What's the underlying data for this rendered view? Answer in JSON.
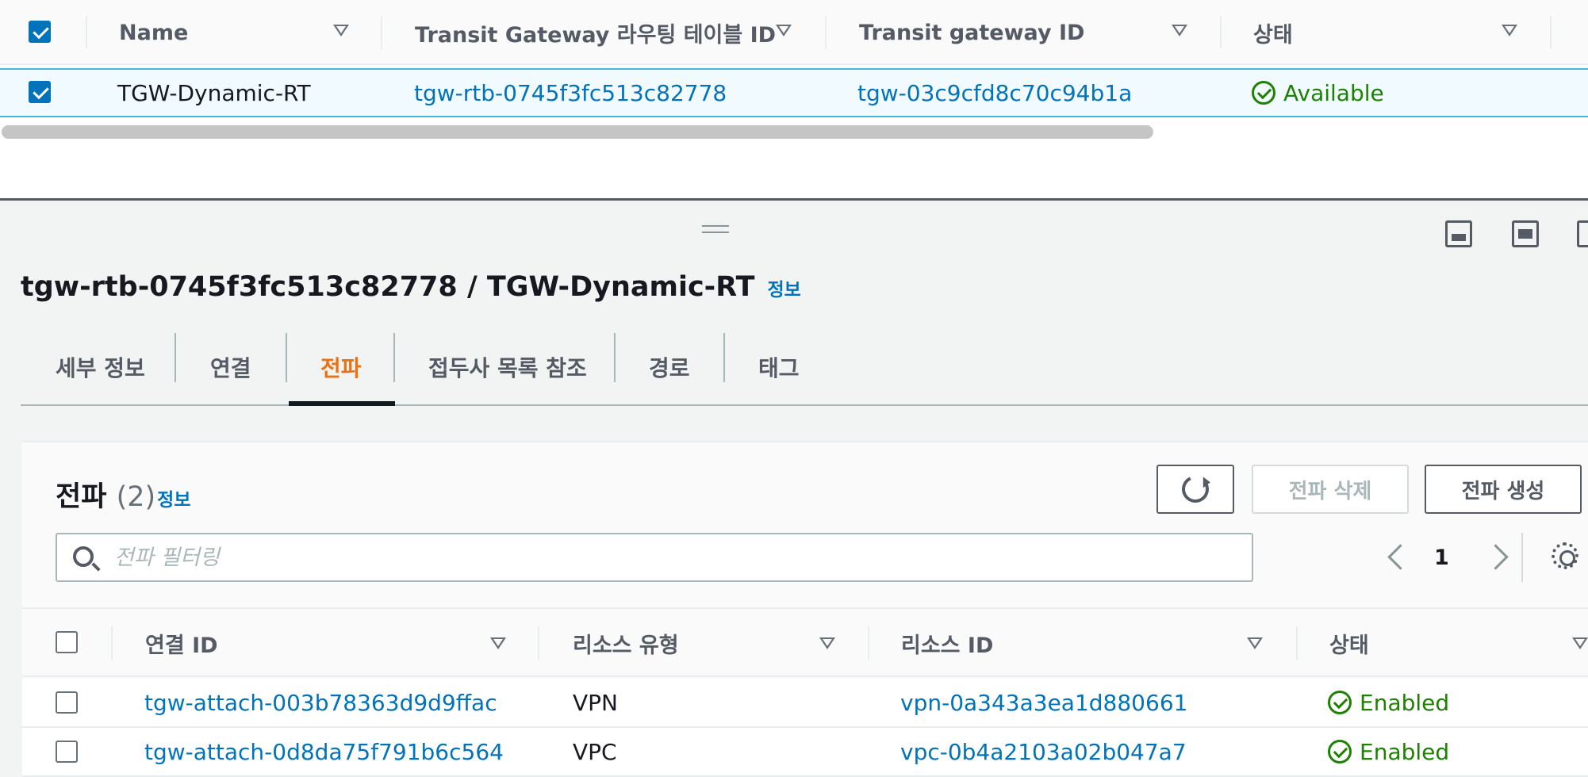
{
  "top_table": {
    "columns": [
      "Name",
      "Transit Gateway 라우팅 테이블 ID",
      "Transit gateway ID",
      "상태"
    ],
    "row": {
      "name": "TGW-Dynamic-RT",
      "route_table_id": "tgw-rtb-0745f3fc513c82778",
      "transit_gateway_id": "tgw-03c9cfd8c70c94b1a",
      "status": "Available"
    }
  },
  "detail": {
    "title": "tgw-rtb-0745f3fc513c82778 / TGW-Dynamic-RT",
    "info": "정보",
    "tabs": [
      "세부 정보",
      "연결",
      "전파",
      "접두사 목록 참조",
      "경로",
      "태그"
    ],
    "active_tab": "전파"
  },
  "propagations": {
    "title": "전파",
    "count": "(2)",
    "info": "정보",
    "delete_button": "전파 삭제",
    "create_button": "전파 생성",
    "filter_placeholder": "전파 필터링",
    "page": "1",
    "columns": [
      "연결 ID",
      "리소스 유형",
      "리소스 ID",
      "상태"
    ],
    "rows": [
      {
        "attachment_id": "tgw-attach-003b78363d9d9ffac",
        "resource_type": "VPN",
        "resource_id": "vpn-0a343a3ea1d880661",
        "status": "Enabled"
      },
      {
        "attachment_id": "tgw-attach-0d8da75f791b6c564",
        "resource_type": "VPC",
        "resource_id": "vpc-0b4a2103a02b047a7",
        "status": "Enabled"
      }
    ]
  },
  "colors": {
    "link": "#0073bb",
    "success": "#1d8102",
    "active_tab": "#ec7211",
    "selected_row_bg": "#f1faff"
  }
}
